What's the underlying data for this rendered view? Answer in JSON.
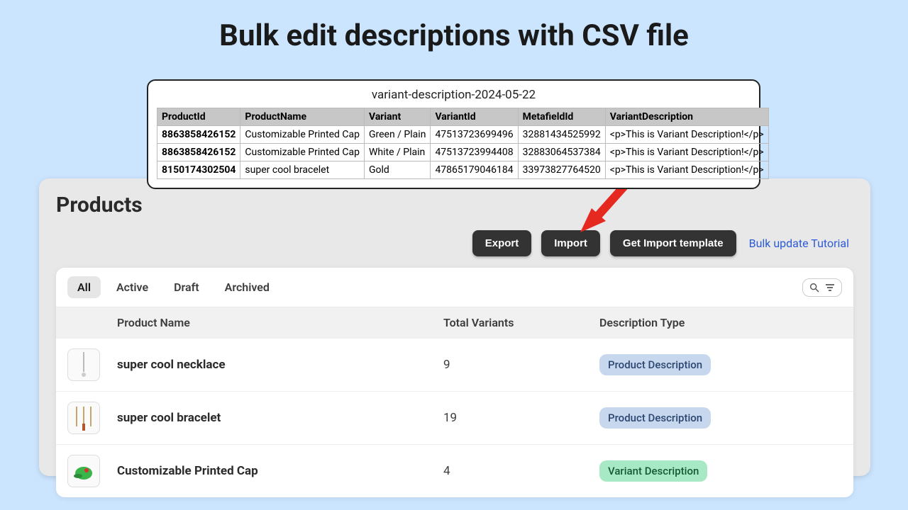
{
  "title": "Bulk edit descriptions with CSV file",
  "csv": {
    "filename": "variant-description-2024-05-22",
    "headers": [
      "ProductId",
      "ProductName",
      "Variant",
      "VariantId",
      "MetafieldId",
      "VariantDescription"
    ],
    "rows": [
      {
        "pid": "8863858426152",
        "pname": "Customizable Printed Cap",
        "variant": "Green / Plain",
        "vid": "47513723699496",
        "mid": "32881434525992",
        "desc": "<p>This is Variant Description!</p>"
      },
      {
        "pid": "8863858426152",
        "pname": "Customizable Printed Cap",
        "variant": "White / Plain",
        "vid": "47513723994408",
        "mid": "32883064537384",
        "desc": "<p>This is Variant Description!</p>"
      },
      {
        "pid": "8150174302504",
        "pname": "super cool bracelet",
        "variant": "Gold",
        "vid": "47865179046184",
        "mid": "33973827764520",
        "desc": "<p>This is Variant Description!</p>"
      }
    ]
  },
  "panel": {
    "title": "Products",
    "actions": {
      "export": "Export",
      "import": "Import",
      "getTemplate": "Get Import template",
      "tutorial": "Bulk update Tutorial"
    },
    "tabs": {
      "all": "All",
      "active": "Active",
      "draft": "Draft",
      "archived": "Archived"
    },
    "columns": {
      "name": "Product Name",
      "variants": "Total Variants",
      "type": "Description Type"
    },
    "products": [
      {
        "name": "super cool necklace",
        "variants": "9",
        "typeLabel": "Product Description",
        "typeKind": "blue",
        "thumb": "necklace"
      },
      {
        "name": "super cool bracelet",
        "variants": "19",
        "typeLabel": "Product Description",
        "typeKind": "blue",
        "thumb": "bracelet"
      },
      {
        "name": "Customizable Printed Cap",
        "variants": "4",
        "typeLabel": "Variant Description",
        "typeKind": "green",
        "thumb": "cap"
      }
    ]
  }
}
